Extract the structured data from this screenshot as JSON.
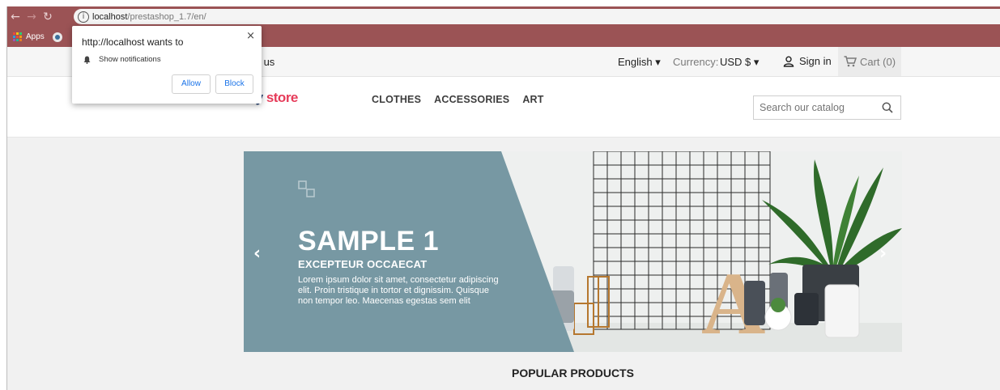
{
  "browser": {
    "url_host": "localhost",
    "url_path": "/prestashop_1.7/en/",
    "bookmarks": {
      "apps_label": "Apps",
      "second_label": ""
    }
  },
  "notification_popup": {
    "title": "http://localhost wants to",
    "permission": "Show notifications",
    "allow_label": "Allow",
    "block_label": "Block",
    "close_glyph": "×"
  },
  "topnav": {
    "contact_label": "tact us",
    "language": "English ▾",
    "currency_label": "Currency:",
    "currency_value": "USD $ ▾",
    "signin_label": "Sign in",
    "cart_label": "Cart (0)"
  },
  "header": {
    "logo_part1": "my",
    "logo_part2": "store",
    "menu": [
      "CLOTHES",
      "ACCESSORIES",
      "ART"
    ],
    "search_placeholder": "Search our catalog"
  },
  "slider": {
    "title": "SAMPLE 1",
    "subtitle": "EXCEPTEUR OCCAECAT",
    "body": "Lorem ipsum dolor sit amet, consectetur adipiscing elit. Proin tristique in tortor et dignissim. Quisque non tempor leo. Maecenas egestas sem elit",
    "prev_glyph": "‹",
    "next_glyph": "›",
    "panel_color": "#7798a3",
    "letter": "A"
  },
  "section": {
    "popular_title": "POPULAR PRODUCTS"
  },
  "colors": {
    "chrome_bar": "#9b5355",
    "cart_bg": "#ebebeb",
    "link_blue": "#1a73e8"
  }
}
